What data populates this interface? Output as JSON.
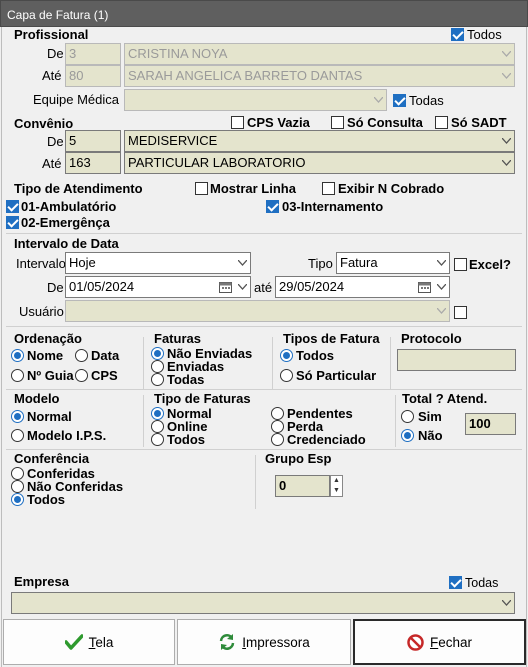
{
  "window": {
    "title": "Capa de Fatura (1)"
  },
  "profissional": {
    "header": "Profissional",
    "todos_label": "Todos",
    "todos_checked": true,
    "de_label": "De",
    "de_code": "3",
    "de_name": "CRISTINA NOYA",
    "ate_label": "Até",
    "ate_code": "80",
    "ate_name": "SARAH ANGELICA BARRETO DANTAS",
    "equipe_label": "Equipe Médica",
    "equipe_value": "",
    "todas_label": "Todas",
    "todas_checked": true
  },
  "convenio": {
    "header": "Convênio",
    "cps_vazia": "CPS Vazia",
    "so_consulta": "Só Consulta",
    "so_sadt": "Só SADT",
    "de_label": "De",
    "de_code": "5",
    "de_name": "MEDISERVICE",
    "ate_label": "Até",
    "ate_code": "163",
    "ate_name": "PARTICULAR LABORATORIO"
  },
  "atendimento": {
    "header": "Tipo de Atendimento",
    "mostrar_linha": "Mostrar Linha",
    "exibir_n_cobrado": "Exibir N Cobrado",
    "ambulatorio": "01-Ambulatório",
    "internamento": "03-Internamento",
    "emergencia": "02-Emergênça"
  },
  "intervalo": {
    "header": "Intervalo de Data",
    "intervalo_label": "Intervalo",
    "intervalo_value": "Hoje",
    "tipo_label": "Tipo",
    "tipo_value": "Fatura",
    "excel_label": "Excel?",
    "de_label": "De",
    "de_date": "01/05/2024",
    "ate_label": "até",
    "ate_date": "29/05/2024",
    "usuario_label": "Usuário",
    "usuario_value": ""
  },
  "ordenacao": {
    "header": "Ordenação",
    "nome": "Nome",
    "data": "Data",
    "n_guia": "Nº Guia",
    "cps": "CPS"
  },
  "faturas": {
    "header": "Faturas",
    "nao_enviadas": "Não Enviadas",
    "enviadas": "Enviadas",
    "todas": "Todas"
  },
  "tipos_fatura": {
    "header": "Tipos de Fatura",
    "todos": "Todos",
    "so_particular": "Só Particular"
  },
  "protocolo": {
    "header": "Protocolo",
    "value": ""
  },
  "modelo": {
    "header": "Modelo",
    "normal": "Normal",
    "ips": "Modelo I.P.S."
  },
  "tipo_faturas": {
    "header": "Tipo de Faturas",
    "normal": "Normal",
    "online": "Online",
    "todos": "Todos",
    "pendentes": "Pendentes",
    "perda": "Perda",
    "credenciado": "Credenciado"
  },
  "total": {
    "header": "Total ? Atend.",
    "sim": "Sim",
    "nao": "Não",
    "value": "100"
  },
  "conferencia": {
    "header": "Conferência",
    "conferidas": "Conferidas",
    "nao_conferidas": "Não Conferidas",
    "todos": "Todos"
  },
  "grupo_esp": {
    "header": "Grupo Esp",
    "value": "0"
  },
  "empresa": {
    "header": "Empresa",
    "todas_label": "Todas",
    "value": ""
  },
  "buttons": {
    "tela_ul": "T",
    "tela_rest": "ela",
    "impressora_ul": "I",
    "impressora_rest": "mpressora",
    "fechar_ul": "F",
    "fechar_rest": "echar"
  },
  "colors": {
    "accent": "#1f6fc2",
    "field_bg": "#e4e4cd",
    "titlebar": "#5f5f5f"
  }
}
